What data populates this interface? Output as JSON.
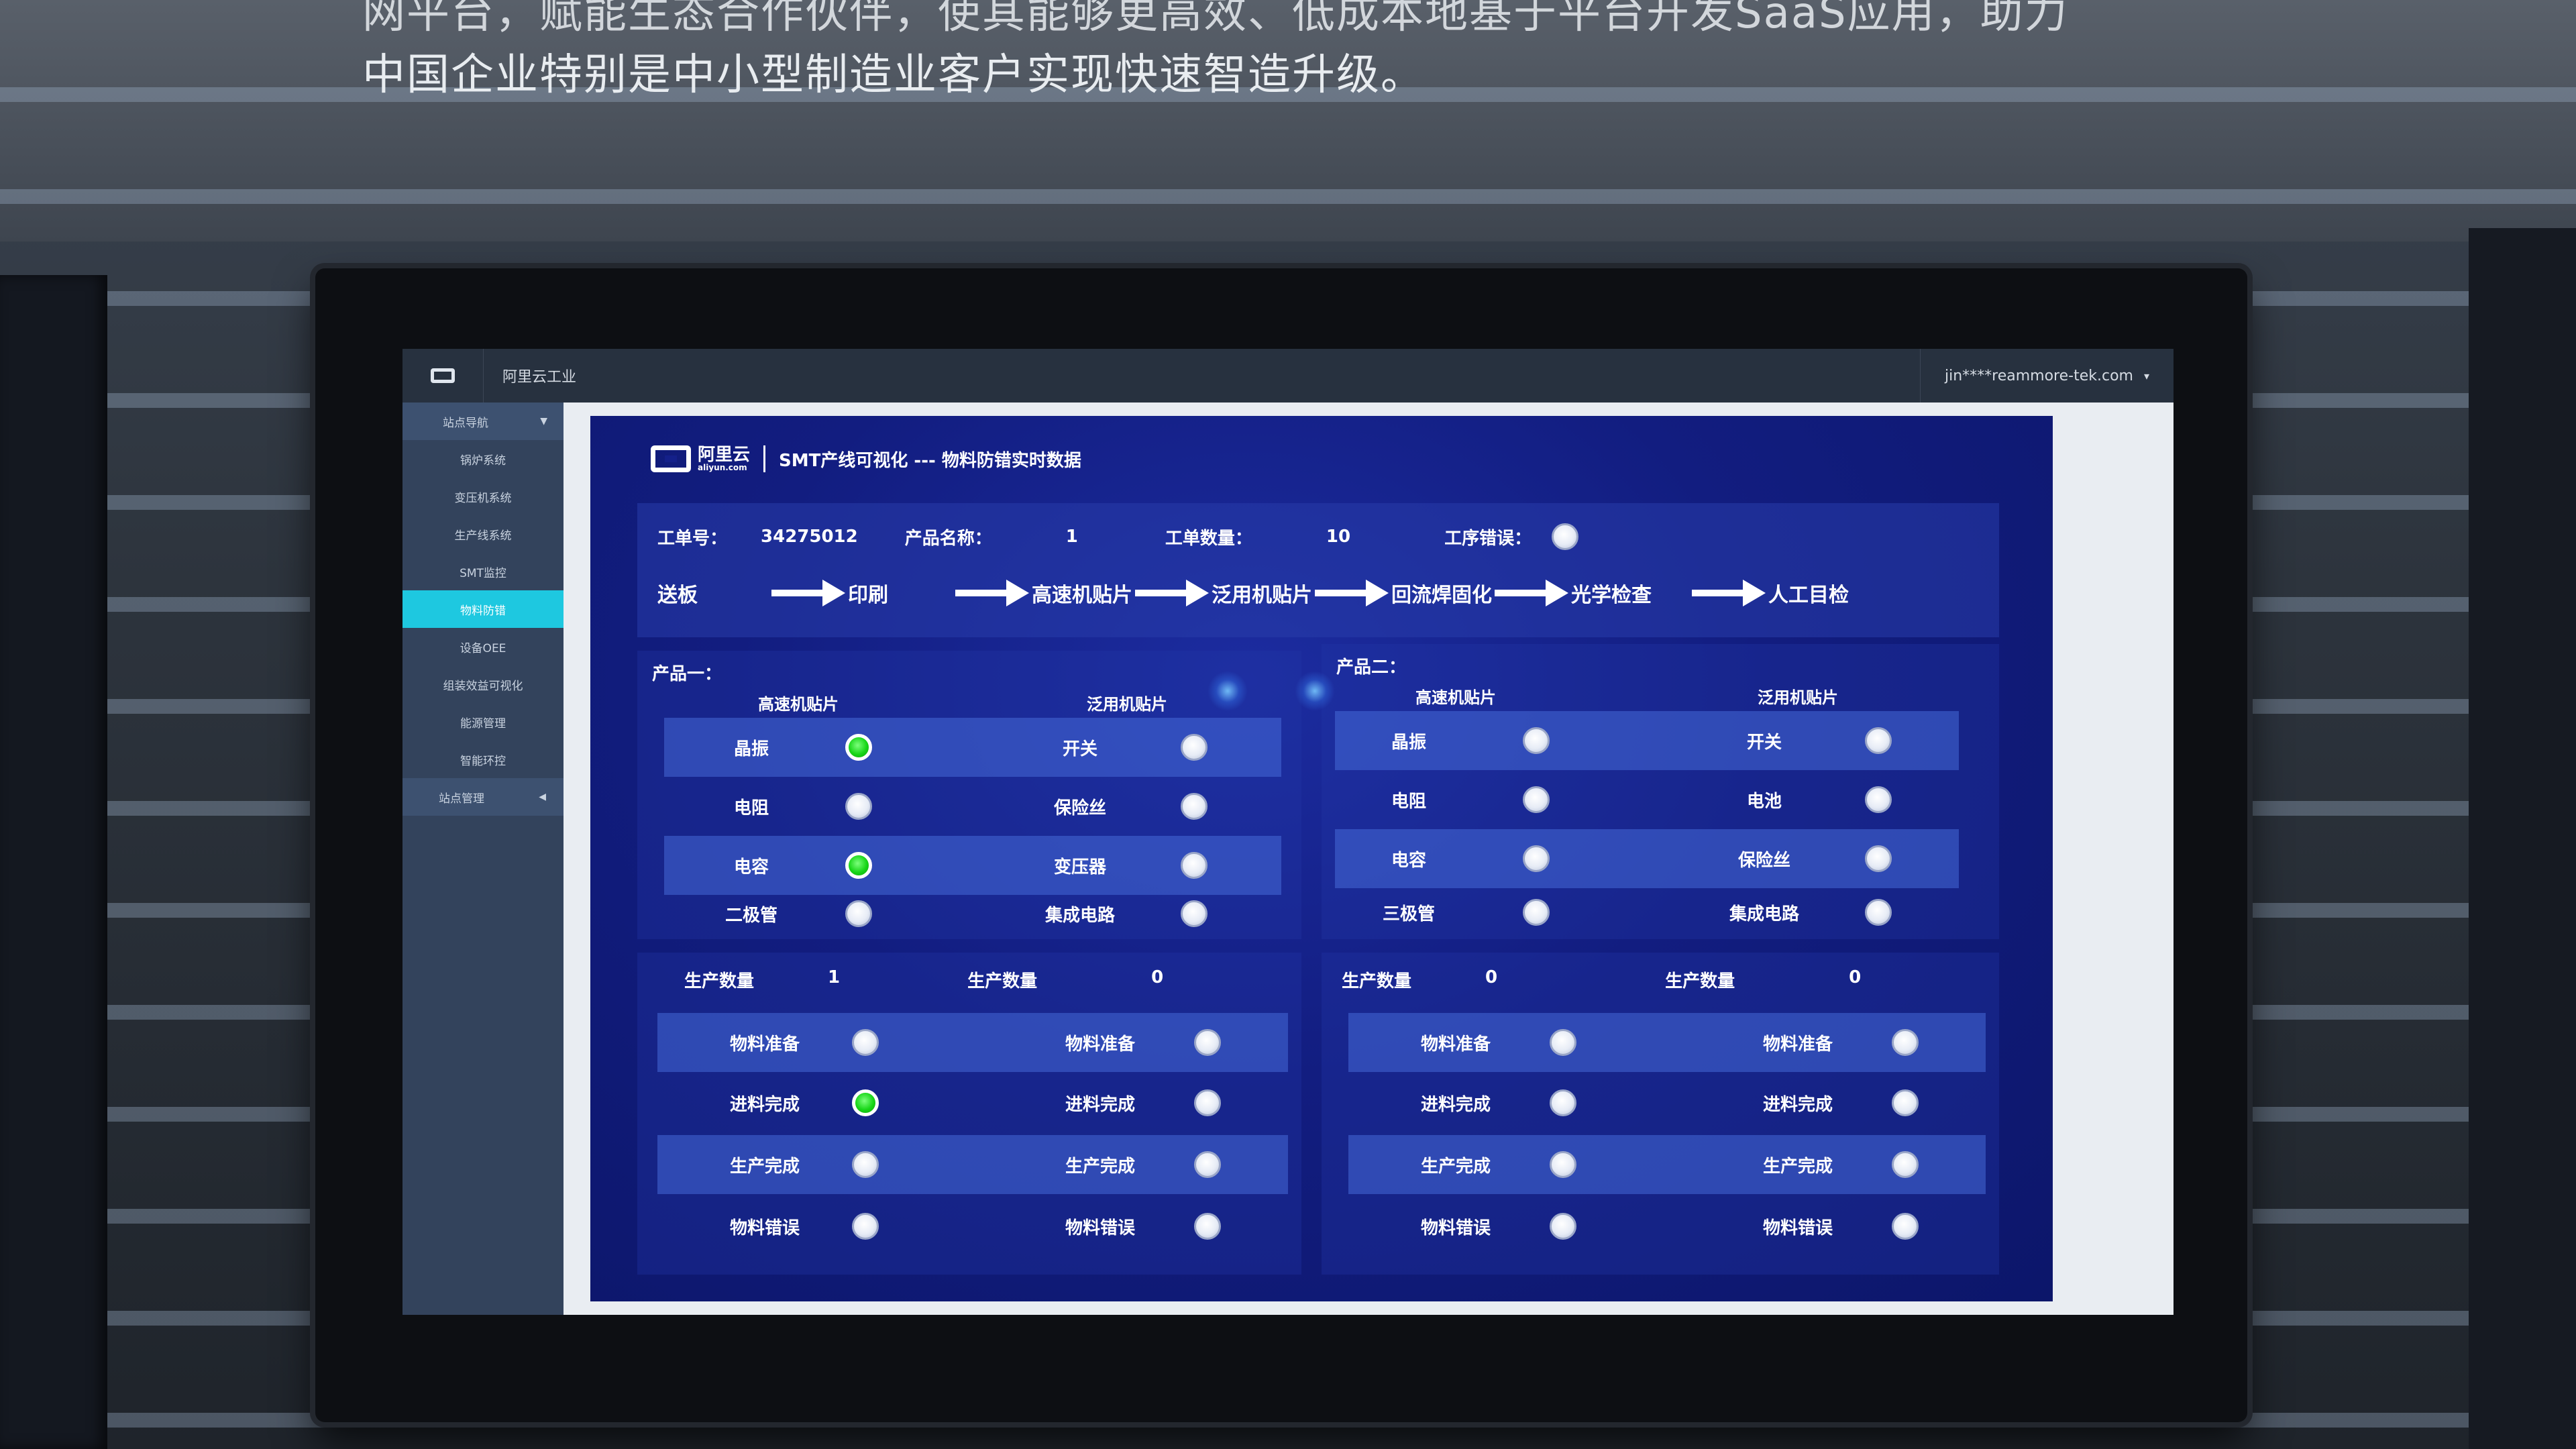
{
  "wall": {
    "line1": "网平台，赋能生态合作伙伴，使其能够更高效、低成本地基于平台开发SaaS应用，助力",
    "line2": "中国企业特别是中小型制造业客户实现快速智造升级。"
  },
  "topbar": {
    "app_title": "阿里云工业",
    "user": "jin****reammore-tek.com",
    "caret": "▾"
  },
  "sidebar": {
    "header": "站点导航",
    "items": [
      {
        "label": "锅炉系统"
      },
      {
        "label": "变压机系统"
      },
      {
        "label": "生产线系统"
      },
      {
        "label": "SMT监控"
      },
      {
        "label": "物料防错"
      },
      {
        "label": "设备OEE"
      },
      {
        "label": "组装效益可视化"
      },
      {
        "label": "能源管理"
      },
      {
        "label": "智能环控"
      }
    ],
    "footer": "站点管理"
  },
  "dashboard": {
    "brand": {
      "name": "阿里云",
      "sub": "aliyun.com"
    },
    "title": "SMT产线可视化 --- 物料防错实时数据",
    "info": {
      "order_label": "工单号：",
      "order_value": "34275012",
      "product_label": "产品名称：",
      "product_value": "1",
      "qty_label": "工单数量：",
      "qty_value": "10",
      "error_label": "工序错误："
    },
    "process": [
      "送板",
      "印刷",
      "高速机贴片",
      "泛用机贴片",
      "回流焊固化",
      "光学检查",
      "人工目检"
    ],
    "product1": {
      "title": "产品一：",
      "col1": "高速机贴片",
      "col2": "泛用机贴片",
      "rows": [
        {
          "a": "晶振",
          "a_on": true,
          "b": "开关",
          "b_on": false
        },
        {
          "a": "电阻",
          "a_on": false,
          "b": "保险丝",
          "b_on": false
        },
        {
          "a": "电容",
          "a_on": true,
          "b": "变压器",
          "b_on": false
        },
        {
          "a": "二极管",
          "a_on": false,
          "b": "集成电路",
          "b_on": false
        }
      ]
    },
    "product2": {
      "title": "产品二：",
      "col1": "高速机贴片",
      "col2": "泛用机贴片",
      "rows": [
        {
          "a": "晶振",
          "a_on": false,
          "b": "开关",
          "b_on": false
        },
        {
          "a": "电阻",
          "a_on": false,
          "b": "电池",
          "b_on": false
        },
        {
          "a": "电容",
          "a_on": false,
          "b": "保险丝",
          "b_on": false
        },
        {
          "a": "三极管",
          "a_on": false,
          "b": "集成电路",
          "b_on": false
        }
      ]
    },
    "status1": {
      "count_label": "生产数量",
      "count_a": "1",
      "count_b": "0",
      "rows": [
        {
          "a": "物料准备",
          "a_on": false,
          "b": "物料准备",
          "b_on": false
        },
        {
          "a": "进料完成",
          "a_on": true,
          "b": "进料完成",
          "b_on": false
        },
        {
          "a": "生产完成",
          "a_on": false,
          "b": "生产完成",
          "b_on": false
        },
        {
          "a": "物料错误",
          "a_on": false,
          "b": "物料错误",
          "b_on": false
        }
      ]
    },
    "status2": {
      "count_label": "生产数量",
      "count_a": "0",
      "count_b": "0",
      "rows": [
        {
          "a": "物料准备",
          "a_on": false,
          "b": "物料准备",
          "b_on": false
        },
        {
          "a": "进料完成",
          "a_on": false,
          "b": "进料完成",
          "b_on": false
        },
        {
          "a": "生产完成",
          "a_on": false,
          "b": "生产完成",
          "b_on": false
        },
        {
          "a": "物料错误",
          "a_on": false,
          "b": "物料错误",
          "b_on": false
        }
      ]
    }
  },
  "colors": {
    "indicator_on": "#18d618",
    "indicator_off": "#e7ecf6",
    "active_nav": "#1ec8e0",
    "dashboard_bg": "#121d80"
  }
}
